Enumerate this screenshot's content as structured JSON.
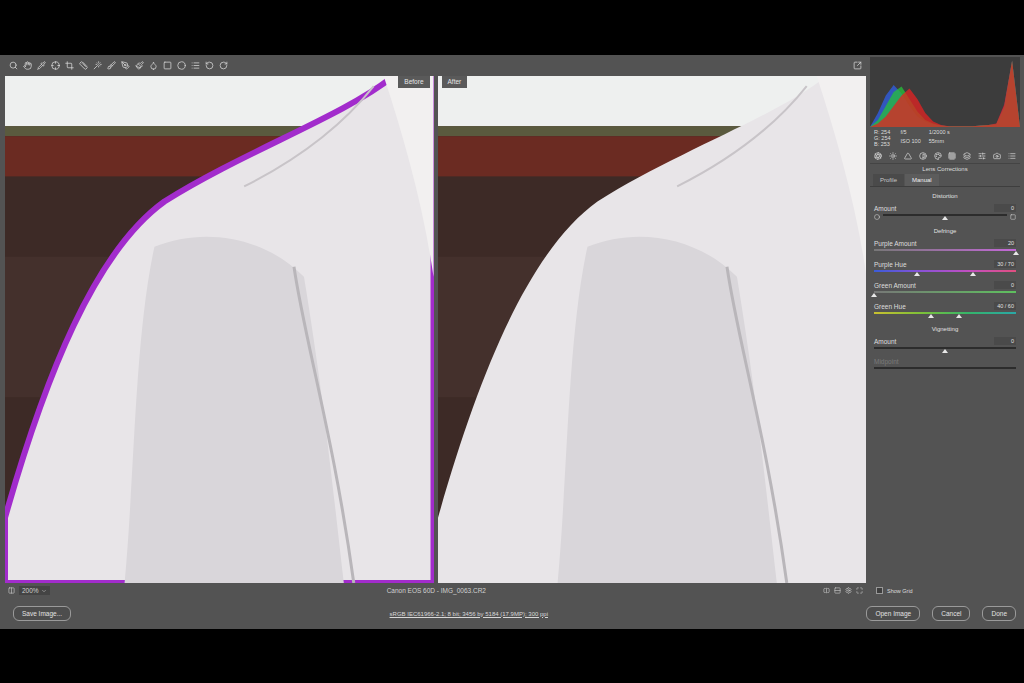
{
  "previews": [
    {
      "label": "Before",
      "fringe": true
    },
    {
      "label": "After",
      "fringe": false
    }
  ],
  "status_bar": {
    "zoom": "200%",
    "filename": "Canon EOS 60D  -  IMG_0063.CR2"
  },
  "histogram": {
    "series": [
      {
        "name": "blue",
        "color": "#2f5fe8",
        "values": [
          0,
          20,
          45,
          60,
          48,
          30,
          15,
          8,
          4,
          2,
          1,
          1,
          1,
          1,
          2,
          3,
          4,
          30,
          95,
          0
        ]
      },
      {
        "name": "green",
        "color": "#27c23a",
        "values": [
          0,
          10,
          30,
          50,
          58,
          40,
          22,
          10,
          5,
          2,
          1,
          1,
          1,
          1,
          2,
          3,
          4,
          28,
          95,
          0
        ]
      },
      {
        "name": "red",
        "color": "#e52222",
        "values": [
          0,
          5,
          15,
          30,
          45,
          55,
          40,
          20,
          8,
          3,
          1,
          1,
          1,
          1,
          2,
          3,
          5,
          32,
          95,
          0
        ]
      }
    ]
  },
  "readout": {
    "rgb": [
      {
        "label": "R:",
        "value": "254"
      },
      {
        "label": "G:",
        "value": "254"
      },
      {
        "label": "B:",
        "value": "253"
      }
    ],
    "camera": [
      "f/5",
      "1/2000 s",
      "ISO 100",
      "55mm"
    ]
  },
  "panel": {
    "title": "Lens Corrections",
    "tabs": [
      {
        "label": "Profile",
        "selected": false
      },
      {
        "label": "Manual",
        "selected": true
      }
    ],
    "sections": [
      {
        "title": "Distortion",
        "sliders": [
          {
            "label": "Amount",
            "value": "0",
            "kind": "distortion",
            "level": 0.5,
            "disabled": false
          }
        ]
      },
      {
        "title": "Defringe",
        "sliders": [
          {
            "label": "Purple Amount",
            "value": "20",
            "kind": "purple-amount",
            "level": 1,
            "disabled": false
          },
          {
            "label": "Purple Hue",
            "value": "30 / 70",
            "kind": "purple-hue",
            "range": [
              0.3,
              0.7
            ],
            "disabled": false
          },
          {
            "label": "Green Amount",
            "value": "0",
            "kind": "green-amount",
            "level": 0,
            "disabled": false
          },
          {
            "label": "Green Hue",
            "value": "40 / 60",
            "kind": "green-hue",
            "range": [
              0.4,
              0.6
            ],
            "disabled": false
          }
        ]
      },
      {
        "title": "Vignetting",
        "sliders": [
          {
            "label": "Amount",
            "value": "0",
            "kind": "plain",
            "level": 0.5,
            "disabled": false
          },
          {
            "label": "Midpoint",
            "kind": "plain",
            "level": 0.5,
            "disabled": true
          }
        ]
      }
    ]
  },
  "show_grid": {
    "label": "Show Grid",
    "checked": false
  },
  "footer": {
    "save_button": "Save Image...",
    "workflow": "sRGB IEC61966-2.1; 8 bit; 3456 by 5184 (17.9MP); 300 ppi",
    "buttons": [
      "Open Image",
      "Cancel",
      "Done"
    ]
  }
}
